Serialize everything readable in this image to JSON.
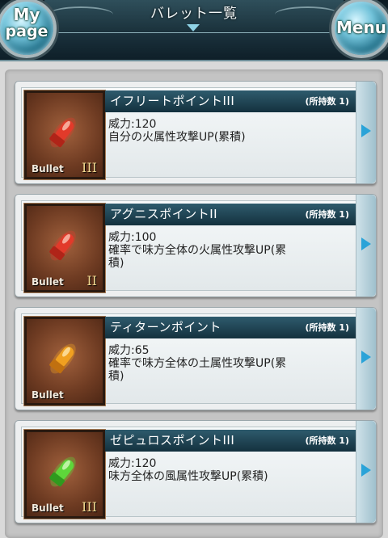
{
  "header": {
    "title": "バレット一覧",
    "mypage_line1": "My",
    "mypage_line2": "page",
    "menu_label": "Menu"
  },
  "bullets": [
    {
      "name": "イフリートポイントIII",
      "count_label": "(所持数 1)",
      "power": "威力:120",
      "desc_line1": "自分の火属性攻撃UP(累積)",
      "desc_line2": "",
      "type_label": "Bullet",
      "rank": "III",
      "color": "#e23a2a"
    },
    {
      "name": "アグニスポイントII",
      "count_label": "(所持数 1)",
      "power": "威力:100",
      "desc_line1": "確率で味方全体の火属性攻撃UP(累",
      "desc_line2": "積)",
      "type_label": "Bullet",
      "rank": "II",
      "color": "#e23a2a"
    },
    {
      "name": "ティターンポイント",
      "count_label": "(所持数 1)",
      "power": "威力:65",
      "desc_line1": "確率で味方全体の土属性攻撃UP(累",
      "desc_line2": "積)",
      "type_label": "Bullet",
      "rank": "",
      "color": "#f0a020"
    },
    {
      "name": "ゼピュロスポイントIII",
      "count_label": "(所持数 1)",
      "power": "威力:120",
      "desc_line1": "味方全体の風属性攻撃UP(累積)",
      "desc_line2": "",
      "type_label": "Bullet",
      "rank": "III",
      "color": "#5ed63a"
    }
  ]
}
